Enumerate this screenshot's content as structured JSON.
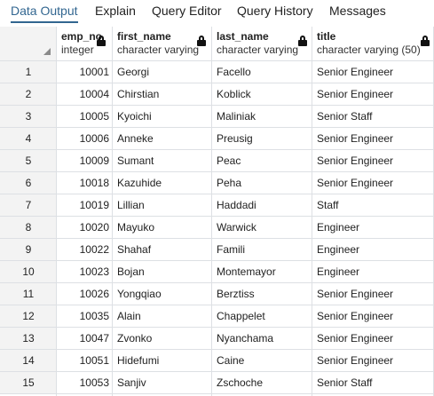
{
  "tabs": [
    {
      "label": "Data Output",
      "active": true
    },
    {
      "label": "Explain"
    },
    {
      "label": "Query Editor"
    },
    {
      "label": "Query History"
    },
    {
      "label": "Messages"
    }
  ],
  "columns": [
    {
      "name": "emp_no",
      "type": "integer",
      "icon": "lock-icon"
    },
    {
      "name": "first_name",
      "type": "character varying",
      "icon": "lock-icon"
    },
    {
      "name": "last_name",
      "type": "character varying",
      "icon": "lock-icon"
    },
    {
      "name": "title",
      "type": "character varying (50)",
      "icon": "lock-icon"
    }
  ],
  "rows": [
    {
      "n": "1",
      "emp_no": "10001",
      "first_name": "Georgi",
      "last_name": "Facello",
      "title": "Senior Engineer"
    },
    {
      "n": "2",
      "emp_no": "10004",
      "first_name": "Chirstian",
      "last_name": "Koblick",
      "title": "Senior Engineer"
    },
    {
      "n": "3",
      "emp_no": "10005",
      "first_name": "Kyoichi",
      "last_name": "Maliniak",
      "title": "Senior Staff"
    },
    {
      "n": "4",
      "emp_no": "10006",
      "first_name": "Anneke",
      "last_name": "Preusig",
      "title": "Senior Engineer"
    },
    {
      "n": "5",
      "emp_no": "10009",
      "first_name": "Sumant",
      "last_name": "Peac",
      "title": "Senior Engineer"
    },
    {
      "n": "6",
      "emp_no": "10018",
      "first_name": "Kazuhide",
      "last_name": "Peha",
      "title": "Senior Engineer"
    },
    {
      "n": "7",
      "emp_no": "10019",
      "first_name": "Lillian",
      "last_name": "Haddadi",
      "title": "Staff"
    },
    {
      "n": "8",
      "emp_no": "10020",
      "first_name": "Mayuko",
      "last_name": "Warwick",
      "title": "Engineer"
    },
    {
      "n": "9",
      "emp_no": "10022",
      "first_name": "Shahaf",
      "last_name": "Famili",
      "title": "Engineer"
    },
    {
      "n": "10",
      "emp_no": "10023",
      "first_name": "Bojan",
      "last_name": "Montemayor",
      "title": "Engineer"
    },
    {
      "n": "11",
      "emp_no": "10026",
      "first_name": "Yongqiao",
      "last_name": "Berztiss",
      "title": "Senior Engineer"
    },
    {
      "n": "12",
      "emp_no": "10035",
      "first_name": "Alain",
      "last_name": "Chappelet",
      "title": "Senior Engineer"
    },
    {
      "n": "13",
      "emp_no": "10047",
      "first_name": "Zvonko",
      "last_name": "Nyanchama",
      "title": "Senior Engineer"
    },
    {
      "n": "14",
      "emp_no": "10051",
      "first_name": "Hidefumi",
      "last_name": "Caine",
      "title": "Senior Engineer"
    },
    {
      "n": "15",
      "emp_no": "10053",
      "first_name": "Sanjiv",
      "last_name": "Zschoche",
      "title": "Senior Staff"
    }
  ],
  "colors": {
    "accent": "#326690",
    "grid_line": "#dde0e4",
    "header_bg": "#f3f3f3"
  }
}
